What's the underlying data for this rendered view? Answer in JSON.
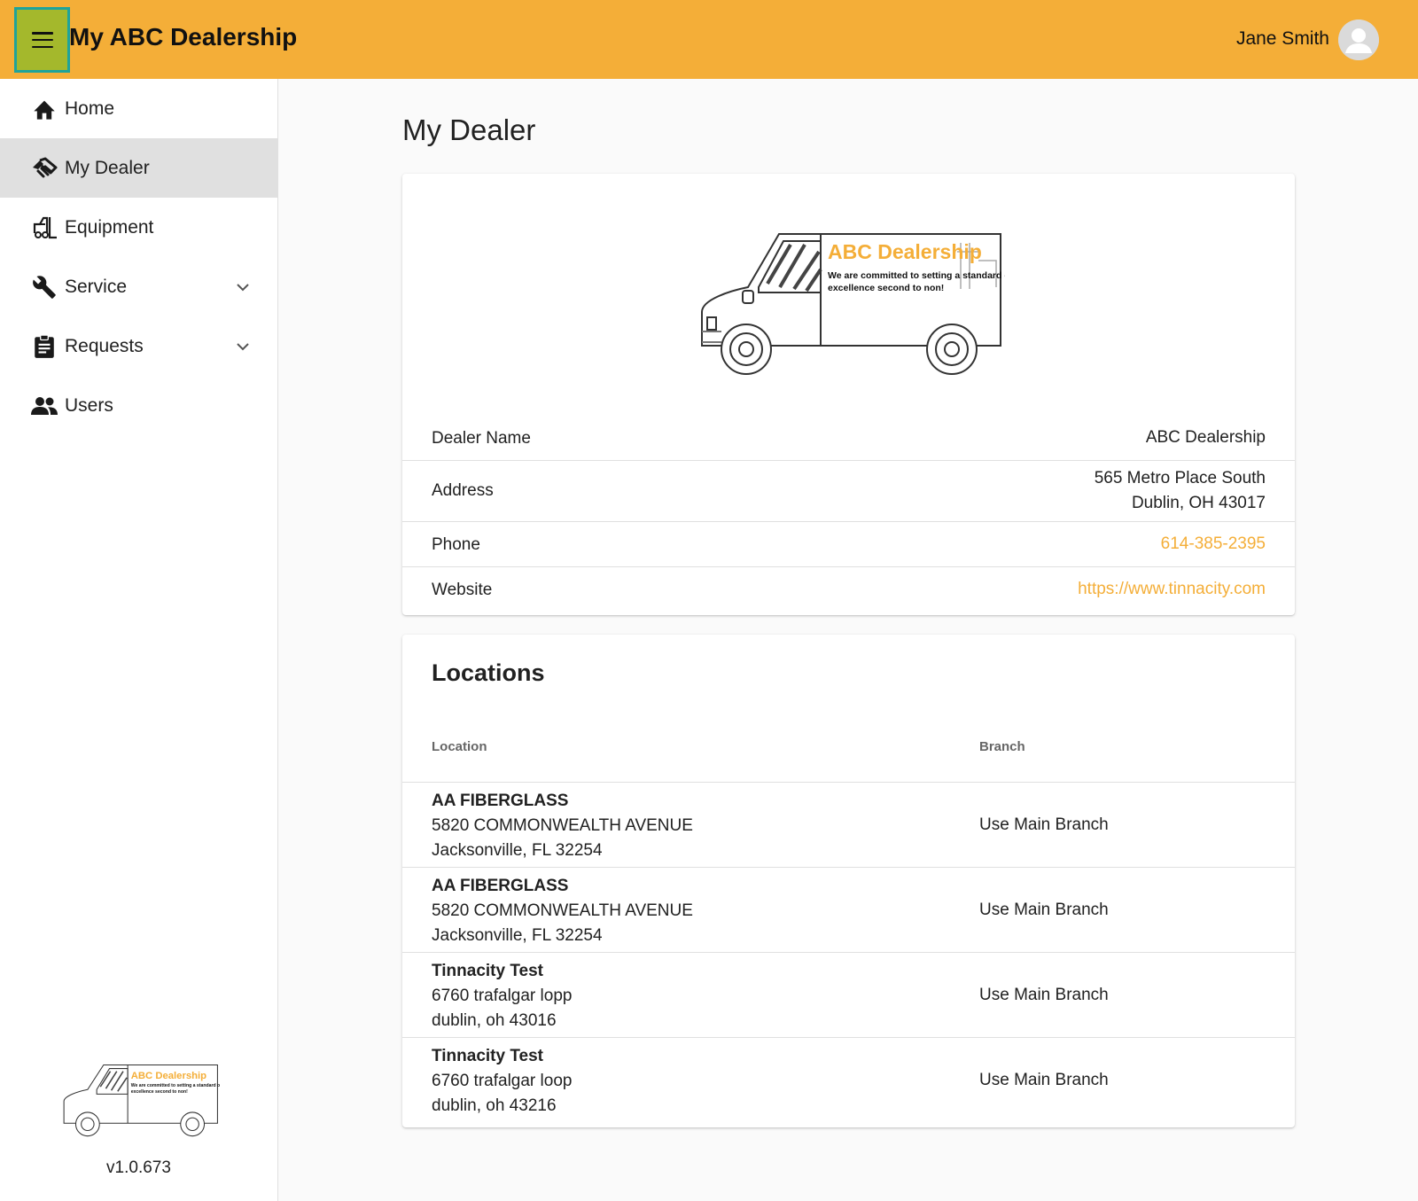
{
  "header": {
    "menu_icon": "menu-icon",
    "title": "My ABC Dealership",
    "user_name": "Jane Smith",
    "avatar_icon": "account-circle-icon",
    "brand_color": "#f4ae38"
  },
  "sidebar": {
    "items": [
      {
        "label": "Home",
        "icon": "home-icon"
      },
      {
        "label": "My Dealer",
        "icon": "handshake-icon",
        "active": true
      },
      {
        "label": "Equipment",
        "icon": "forklift-icon"
      },
      {
        "label": "Service",
        "icon": "wrench-icon",
        "expandable": true
      },
      {
        "label": "Requests",
        "icon": "clipboard-icon",
        "expandable": true
      },
      {
        "label": "Users",
        "icon": "users-icon"
      }
    ],
    "version": "v1.0.673"
  },
  "logo": {
    "brand": "ABC Dealership",
    "tagline_line1": "We are committed to setting a standard of",
    "tagline_line2": "excellence second to non!"
  },
  "page": {
    "title": "My Dealer"
  },
  "dealer": {
    "name_label": "Dealer Name",
    "name_value": "ABC Dealership",
    "address_label": "Address",
    "address_line1": "565 Metro Place South",
    "address_line2": "Dublin, OH 43017",
    "phone_label": "Phone",
    "phone_value": "614-385-2395",
    "website_label": "Website",
    "website_value": "https://www.tinnacity.com"
  },
  "locations": {
    "title": "Locations",
    "columns": {
      "location": "Location",
      "branch": "Branch"
    },
    "rows": [
      {
        "name": "AA FIBERGLASS",
        "street": "5820 COMMONWEALTH AVENUE",
        "city": "Jacksonville, FL 32254",
        "branch": "Use Main Branch"
      },
      {
        "name": "AA FIBERGLASS",
        "street": "5820 COMMONWEALTH AVENUE",
        "city": "Jacksonville, FL 32254",
        "branch": "Use Main Branch"
      },
      {
        "name": "Tinnacity Test",
        "street": "6760 trafalgar lopp",
        "city": "dublin, oh 43016",
        "branch": "Use Main Branch"
      },
      {
        "name": "Tinnacity Test",
        "street": "6760 trafalgar loop",
        "city": "dublin, oh 43216",
        "branch": "Use Main Branch"
      }
    ]
  }
}
